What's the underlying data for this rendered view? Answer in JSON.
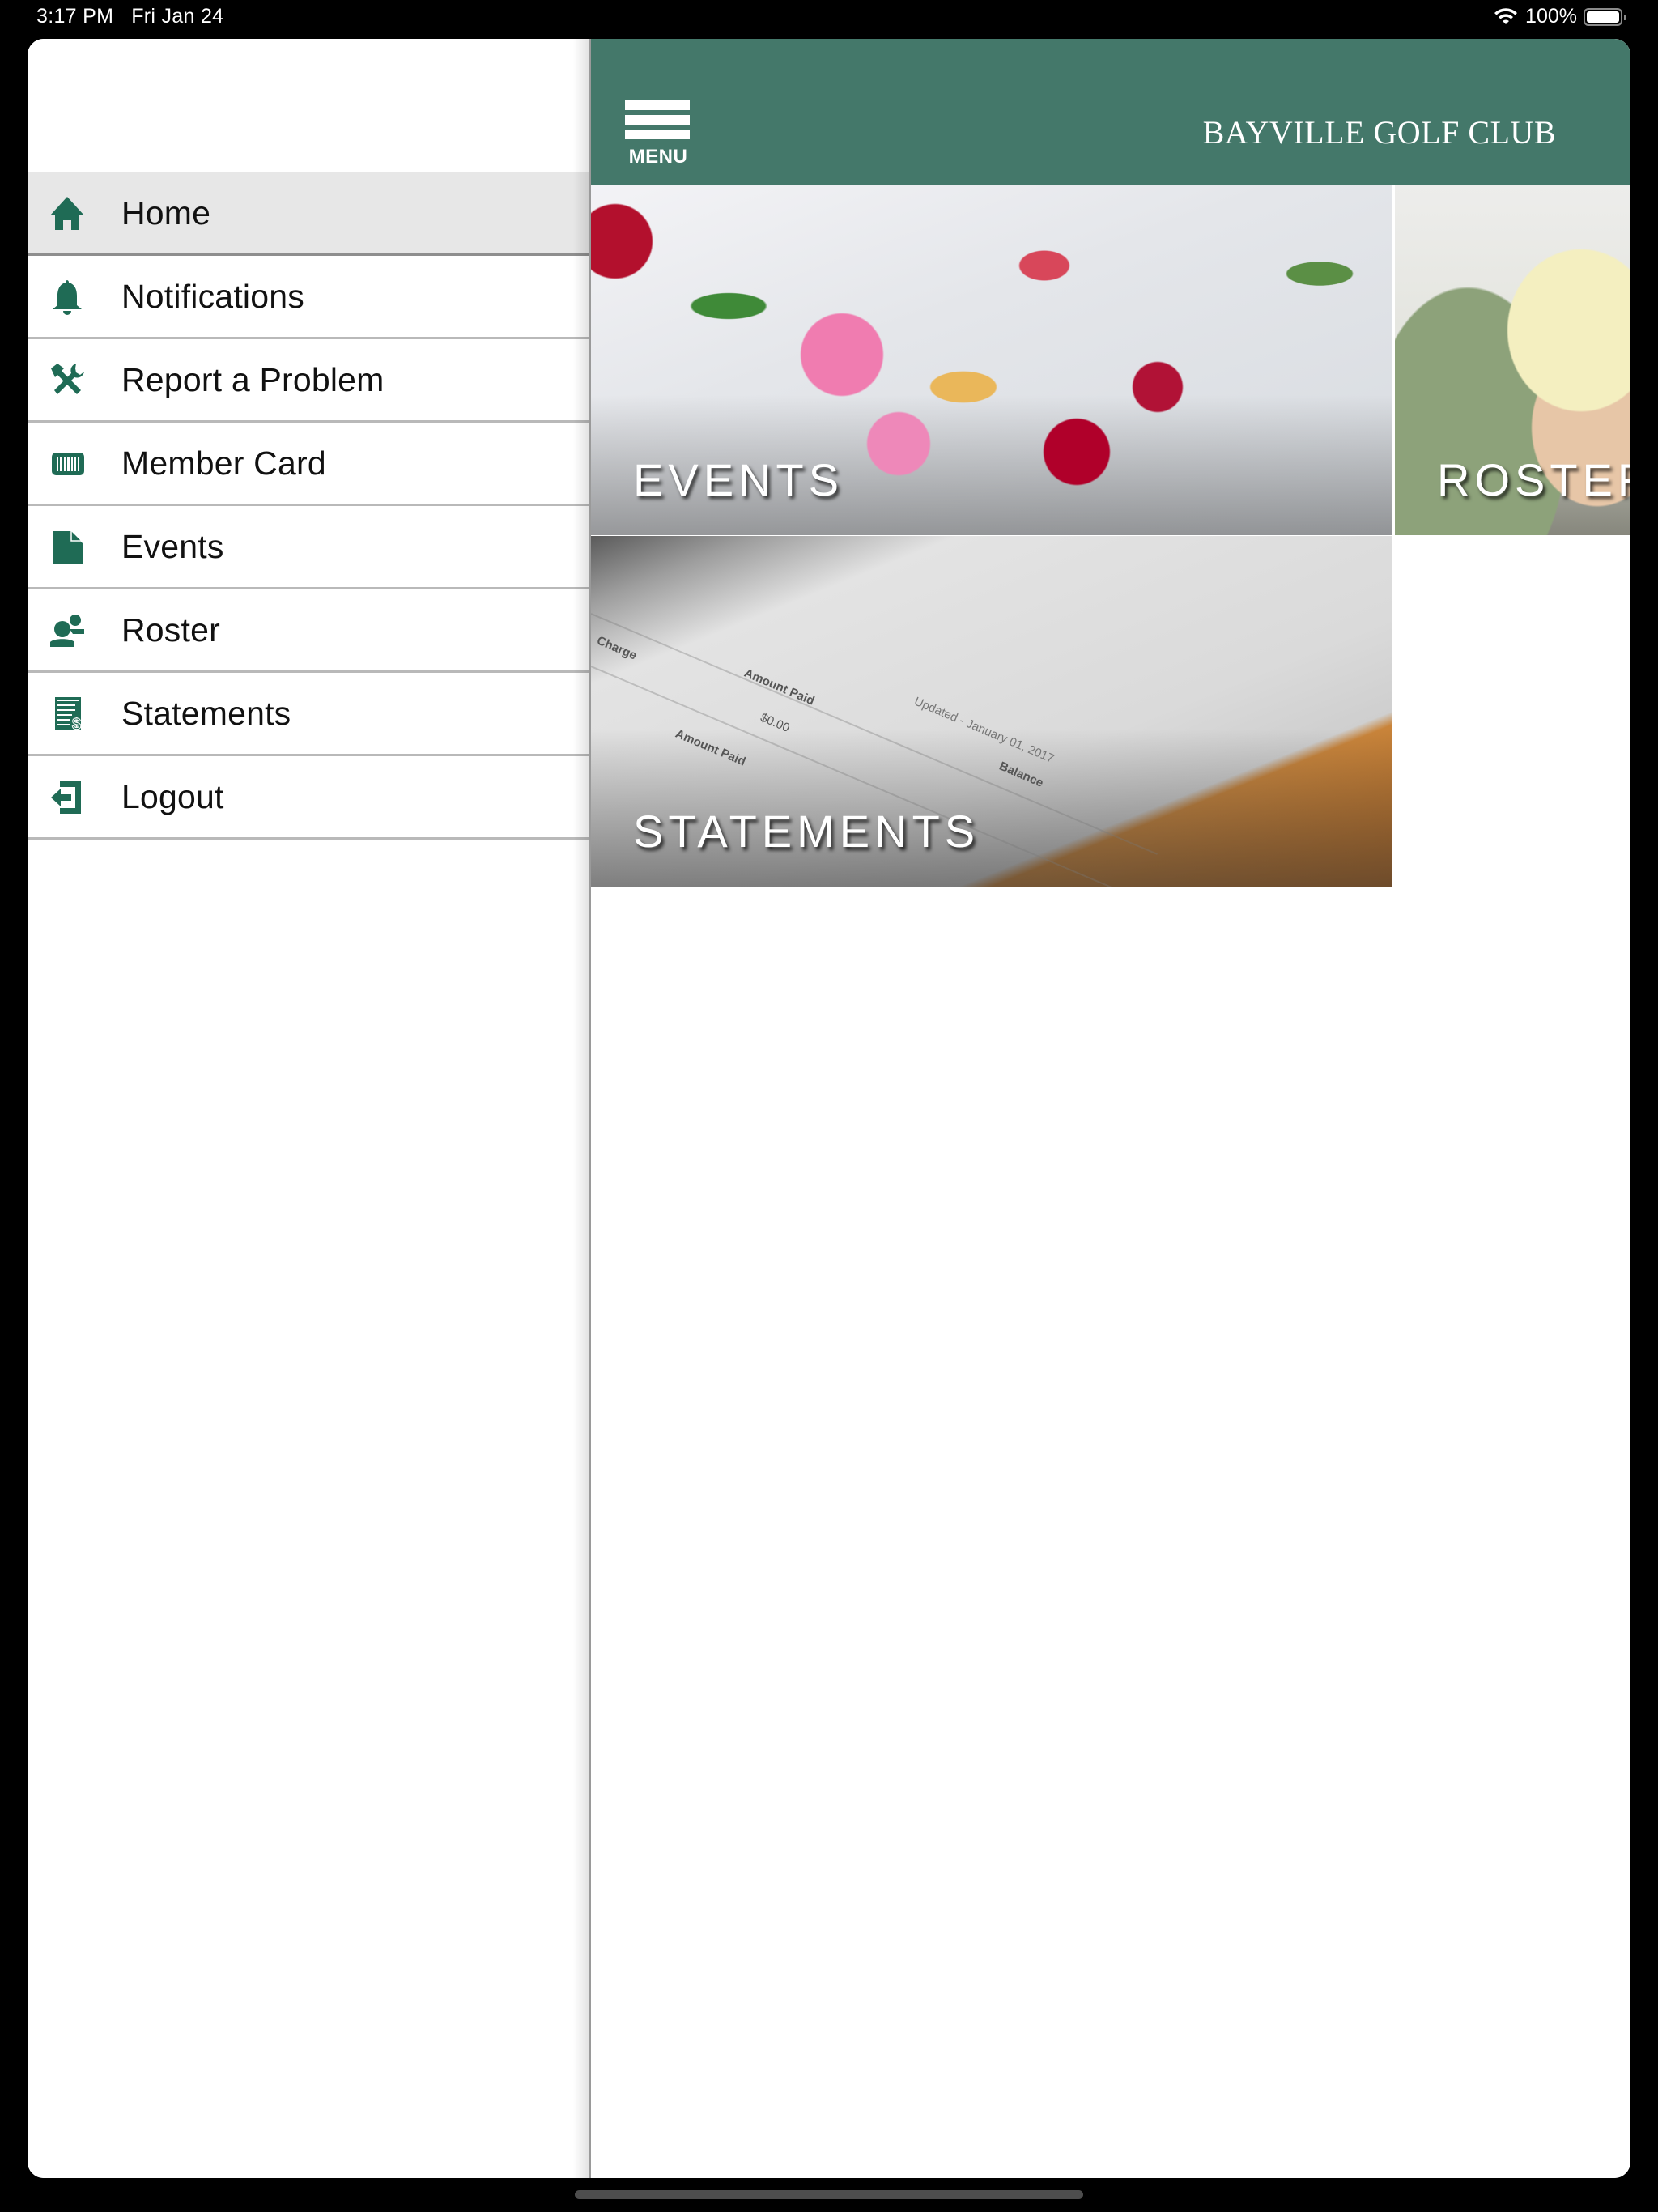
{
  "status_bar": {
    "time": "3:17 PM",
    "date": "Fri Jan 24",
    "battery": "100%",
    "icons": [
      "wifi-icon",
      "battery-icon"
    ]
  },
  "header": {
    "menu_label": "MENU",
    "club_name": "BAYVILLE GOLF CLUB",
    "color": "#44786a"
  },
  "drawer": {
    "accent_color": "#1f6b55",
    "active_item": "Home",
    "items": [
      {
        "label": "Home",
        "icon": "home-icon"
      },
      {
        "label": "Notifications",
        "icon": "bell-icon"
      },
      {
        "label": "Report a Problem",
        "icon": "tools-icon"
      },
      {
        "label": "Member Card",
        "icon": "barcode-card-icon"
      },
      {
        "label": "Events",
        "icon": "document-icon"
      },
      {
        "label": "Roster",
        "icon": "people-icon"
      },
      {
        "label": "Statements",
        "icon": "statement-dollar-icon"
      },
      {
        "label": "Logout",
        "icon": "logout-icon"
      }
    ]
  },
  "tiles": [
    {
      "label": "EVENTS",
      "image": "banquet table with flowers"
    },
    {
      "label": "ROSTER",
      "image": "golfer woman in cap"
    },
    {
      "label": "STATEMENTS",
      "image": "printed account statement"
    }
  ],
  "statement_image_text": {
    "charge": "Charge",
    "amount_paid_1": "Amount Paid",
    "value_1": "$0.00",
    "updated": "Updated - January 01, 2017",
    "amount_paid_2": "Amount Paid",
    "balance": "Balance"
  }
}
